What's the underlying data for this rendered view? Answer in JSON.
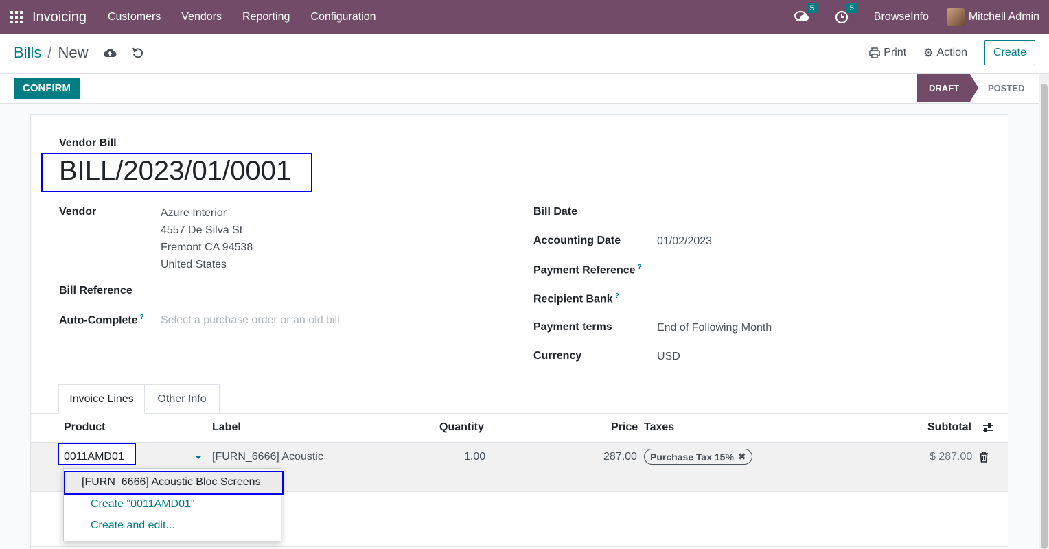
{
  "nav": {
    "app_name": "Invoicing",
    "menu": [
      "Customers",
      "Vendors",
      "Reporting",
      "Configuration"
    ],
    "messages_count": "5",
    "activities_count": "5",
    "company": "BrowseInfo",
    "user": "Mitchell Admin",
    "brand_color": "#714b67"
  },
  "control_panel": {
    "breadcrumb_parent": "Bills",
    "breadcrumb_separator": "/",
    "breadcrumb_current": "New",
    "print_label": "Print",
    "action_label": "Action",
    "create_label": "Create"
  },
  "statusbar": {
    "confirm_label": "CONFIRM",
    "stages": [
      "DRAFT",
      "POSTED"
    ],
    "active_stage": "DRAFT"
  },
  "form": {
    "title_label": "Vendor Bill",
    "bill_number": "BILL/2023/01/0001",
    "vendor_label": "Vendor",
    "vendor_lines": [
      "Azure Interior",
      "4557 De Silva St",
      "Fremont CA 94538",
      "United States"
    ],
    "bill_reference_label": "Bill Reference",
    "auto_complete_label": "Auto-Complete",
    "auto_complete_placeholder": "Select a purchase order or an old bill",
    "help_mark": "?",
    "bill_date_label": "Bill Date",
    "accounting_date_label": "Accounting Date",
    "accounting_date": "01/02/2023",
    "payment_reference_label": "Payment Reference",
    "recipient_bank_label": "Recipient Bank",
    "payment_terms_label": "Payment terms",
    "payment_terms": "End of Following Month",
    "currency_label": "Currency",
    "currency": "USD"
  },
  "tabs": [
    "Invoice Lines",
    "Other Info"
  ],
  "table": {
    "headers": {
      "product": "Product",
      "label": "Label",
      "quantity": "Quantity",
      "price": "Price",
      "taxes": "Taxes",
      "subtotal": "Subtotal"
    },
    "row": {
      "product_input": "0011AMD01",
      "label": "[FURN_6666] Acoustic",
      "quantity": "1.00",
      "price": "287.00",
      "tax": "Purchase Tax 15%",
      "subtotal": "$ 287.00"
    }
  },
  "dropdown": {
    "options": [
      "[FURN_6666] Acoustic Bloc Screens"
    ],
    "create_label": "Create \"0011AMD01\"",
    "create_edit_label": "Create and edit..."
  }
}
